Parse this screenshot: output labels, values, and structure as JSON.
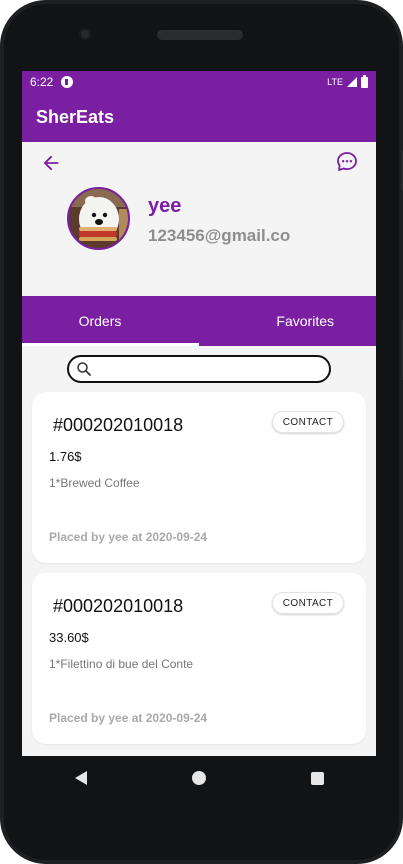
{
  "status_bar": {
    "time": "6:22",
    "network": "LTE"
  },
  "app_bar": {
    "title": "SherEats"
  },
  "profile": {
    "name": "yee",
    "email": "123456@gmail.co"
  },
  "tabs": [
    {
      "label": "Orders",
      "selected": true
    },
    {
      "label": "Favorites",
      "selected": false
    }
  ],
  "search": {
    "value": "",
    "placeholder": ""
  },
  "orders": [
    {
      "order_id": "#000202010018",
      "contact_label": "CONTACT",
      "price": "1.76$",
      "items": "1*Brewed Coffee",
      "placed": "Placed by yee at 2020-09-24"
    },
    {
      "order_id": "#000202010018",
      "contact_label": "CONTACT",
      "price": "33.60$",
      "items": "1*Filettino di bue del Conte",
      "placed": "Placed by yee at 2020-09-24"
    }
  ],
  "colors": {
    "primary": "#7b1fa2",
    "background": "#f4f4f4",
    "muted_text": "#8e8e8e"
  },
  "icons": [
    "back-arrow-icon",
    "chat-bubble-icon",
    "search-icon",
    "nav-back-icon",
    "nav-home-icon",
    "nav-recents-icon"
  ]
}
